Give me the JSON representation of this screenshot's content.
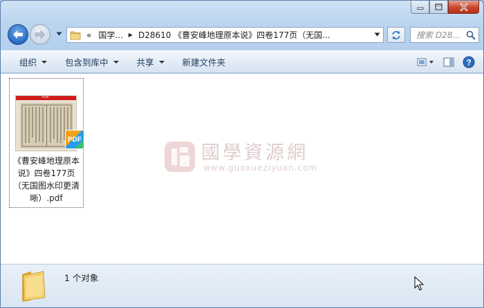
{
  "window": {
    "controls": {
      "minimize": "minimize",
      "maximize": "maximize",
      "close": "close"
    }
  },
  "address_bar": {
    "overflow_chevron": "«",
    "breadcrumbs": [
      "国学...",
      "D28610 《曹安峰地理原本说》四卷177页（无国..."
    ],
    "search_placeholder": "搜索 D28..."
  },
  "toolbar": {
    "organize": "组织",
    "include_in_library": "包含到库中",
    "share": "共享",
    "new_folder": "新建文件夹"
  },
  "files": [
    {
      "name": "《曹安峰地理原本说》四卷177页（无国图水印更清晰）.pdf",
      "badge": "PDF",
      "thumb_label": "PDF"
    }
  ],
  "watermark": {
    "title": "國學資源網",
    "url": "www.guoxueziyuan.com"
  },
  "details_pane": {
    "count_text": "1 个对象"
  },
  "colors": {
    "accent": "#1e395b",
    "window_frame": "#b4d0ee",
    "close_button": "#c9452b"
  }
}
